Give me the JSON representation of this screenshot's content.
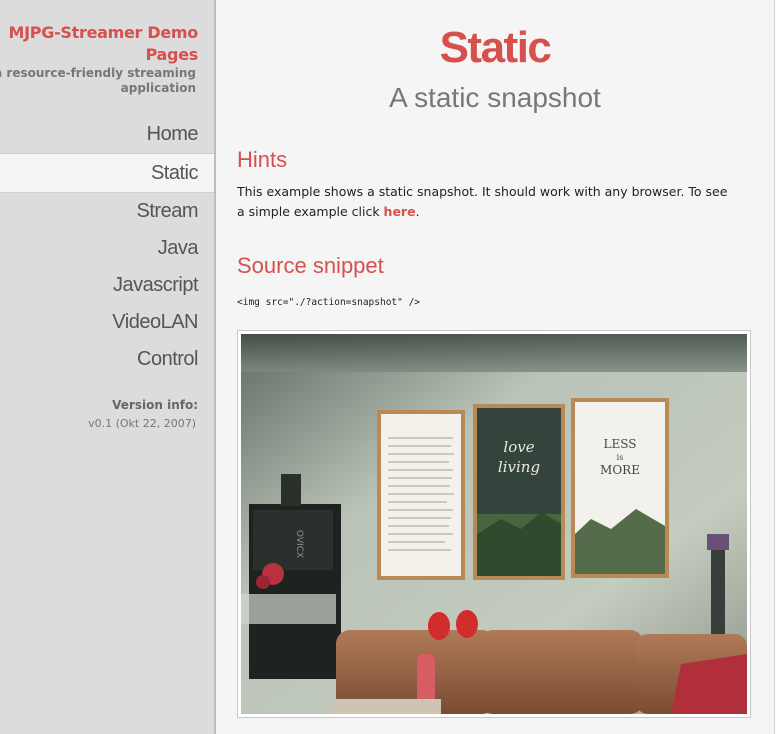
{
  "sidebar": {
    "brand_title": "MJPG-Streamer Demo Pages",
    "brand_subtitle": "a resource-friendly streaming application",
    "nav": [
      {
        "label": "Home",
        "active": false
      },
      {
        "label": "Static",
        "active": true
      },
      {
        "label": "Stream",
        "active": false
      },
      {
        "label": "Java",
        "active": false
      },
      {
        "label": "Javascript",
        "active": false
      },
      {
        "label": "VideoLAN",
        "active": false
      },
      {
        "label": "Control",
        "active": false
      }
    ],
    "version_label": "Version info:",
    "version_value": "v0.1 (Okt 22, 2007)"
  },
  "main": {
    "title": "Static",
    "subtitle": "A static snapshot",
    "hints_heading": "Hints",
    "hints_text_before": "This example shows a static snapshot. It should work with any browser. To see a simple example click ",
    "hints_link": "here",
    "hints_text_after": ".",
    "source_heading": "Source snippet",
    "source_code": "<img src=\"./?action=snapshot\" />",
    "snapshot_poster_texts": [
      "love living",
      "LESS is MORE"
    ],
    "snapshot_device_text": "OVICX"
  },
  "colors": {
    "accent": "#d6504e",
    "sidebar_bg": "#dcdcdc",
    "content_bg": "#f5f5f5"
  }
}
